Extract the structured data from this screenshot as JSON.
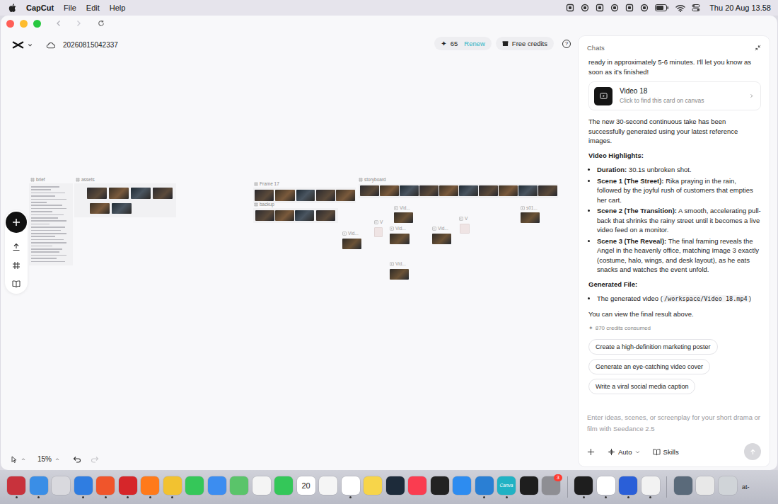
{
  "menubar": {
    "app": "CapCut",
    "menus": [
      "File",
      "Edit",
      "Help"
    ],
    "clock": "Thu 20 Aug 13.58"
  },
  "toolbar": {
    "project": "20260815042337",
    "credits": {
      "icon": "✦",
      "count": "65",
      "action": "Renew"
    },
    "free_credits": "Free credits",
    "help": "?"
  },
  "canvas": {
    "frames": [
      {
        "label": "brief"
      },
      {
        "label": "assets"
      },
      {
        "label": "Frame 17"
      },
      {
        "label": "backup"
      },
      {
        "label": "storyboard"
      }
    ],
    "videos": [
      {
        "label": "Vid...",
        "kind": "done"
      },
      {
        "label": "V",
        "kind": "pending"
      },
      {
        "label": "Vid...",
        "kind": "done"
      },
      {
        "label": "Vid...",
        "kind": "done"
      },
      {
        "label": "Vid...",
        "kind": "done"
      },
      {
        "label": "V",
        "kind": "pending"
      },
      {
        "label": "s01...",
        "kind": "done"
      },
      {
        "label": "Vid...",
        "kind": "done"
      }
    ],
    "zoom": "15%"
  },
  "chat": {
    "title": "Chats",
    "intro": "ready in approximately 5-6 minutes. I'll let you know as soon as it's finished!",
    "card": {
      "title": "Video 18",
      "subtitle": "Click to find this card on canvas"
    },
    "summary": "The new 30-second continuous take has been successfully generated using your latest reference images.",
    "highlights_title": "Video Highlights:",
    "highlights": [
      {
        "label": "Duration:",
        "text": "30.1s unbroken shot."
      },
      {
        "label": "Scene 1 (The Street):",
        "text": "Rika praying in the rain, followed by the joyful rush of customers that empties her cart."
      },
      {
        "label": "Scene 2 (The Transition):",
        "text": "A smooth, accelerating pull-back that shrinks the rainy street until it becomes a live video feed on a monitor."
      },
      {
        "label": "Scene 3 (The Reveal):",
        "text": "The final framing reveals the Angel in the heavenly office, matching Image 3 exactly (costume, halo, wings, and desk layout), as he eats snacks and watches the event unfold."
      }
    ],
    "file_title": "Generated File:",
    "file": {
      "prefix": "The generated video (",
      "path": "/workspace/Video 18.mp4",
      "suffix": ")"
    },
    "closing": "You can view the final result above.",
    "credits": {
      "icon": "✦",
      "text": "870 credits consumed"
    },
    "suggestions": [
      "Create a high-definition marketing poster",
      "Generate an eye-catching video cover",
      "Write a viral social media caption"
    ],
    "input": {
      "placeholder": "Enter ideas, scenes, or screenplay for your short drama or film with Seedance 2.5",
      "mode": "Auto",
      "skills": "Skills"
    }
  },
  "dock": {
    "items": [
      {
        "kind": "app",
        "color": "#c8323c",
        "running": true
      },
      {
        "kind": "app",
        "color": "#3a8ee6",
        "running": true
      },
      {
        "kind": "app",
        "color": "#d9d9de",
        "running": false
      },
      {
        "kind": "app",
        "color": "#2f7de1",
        "running": true
      },
      {
        "kind": "app",
        "color": "#f0552b",
        "running": true
      },
      {
        "kind": "app",
        "color": "#d6262a",
        "running": true
      },
      {
        "kind": "app",
        "color": "#ff7a1a",
        "running": true
      },
      {
        "kind": "app",
        "color": "#f2c230",
        "running": true
      },
      {
        "kind": "app",
        "color": "#35c759",
        "running": false
      },
      {
        "kind": "app",
        "color": "#3c8df0",
        "running": false
      },
      {
        "kind": "app",
        "color": "#5ac46a",
        "running": false
      },
      {
        "kind": "app",
        "color": "#f4f4f4",
        "running": false
      },
      {
        "kind": "app",
        "color": "#34c759",
        "running": false
      },
      {
        "kind": "app",
        "color": "#ffffff",
        "running": false,
        "text": "20"
      },
      {
        "kind": "app",
        "color": "#f5f5f5",
        "running": false
      },
      {
        "kind": "app",
        "color": "#ffffff",
        "running": true
      },
      {
        "kind": "app",
        "color": "#f7d54a",
        "running": false
      },
      {
        "kind": "app",
        "color": "#1d2b3a",
        "running": false
      },
      {
        "kind": "app",
        "color": "#fa3c50",
        "running": false
      },
      {
        "kind": "app",
        "color": "#222222",
        "running": false
      },
      {
        "kind": "app",
        "color": "#2d8cf0",
        "running": false
      },
      {
        "kind": "app",
        "color": "#2a7fd4",
        "running": true
      },
      {
        "kind": "app",
        "color": "#20b2c4",
        "running": true,
        "text": "Canva"
      },
      {
        "kind": "app",
        "color": "#1e1e1e",
        "running": false
      },
      {
        "kind": "app",
        "color": "#8e8e93",
        "running": false,
        "badge": "3"
      },
      {
        "kind": "separator"
      },
      {
        "kind": "app",
        "color": "#1e1e1e",
        "running": true
      },
      {
        "kind": "app",
        "color": "#ffffff",
        "running": true
      },
      {
        "kind": "app",
        "color": "#2a5fd8",
        "running": true
      },
      {
        "kind": "app",
        "color": "#f2f2f2",
        "running": true
      },
      {
        "kind": "separator"
      },
      {
        "kind": "app",
        "color": "#5a6a7a",
        "running": false
      },
      {
        "kind": "app",
        "color": "#e8e8e8",
        "running": false
      },
      {
        "kind": "app",
        "color": "#d0d4d8",
        "running": false
      }
    ],
    "overflow_text": "at-"
  }
}
